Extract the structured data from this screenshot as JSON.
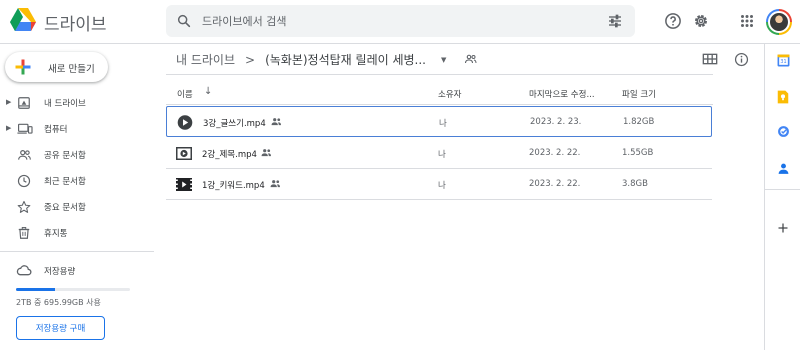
{
  "app": {
    "title": "드라이브",
    "colors": {
      "accent": "#1a73e8",
      "border": "#dadce0",
      "search_bg": "#f1f3f4"
    }
  },
  "header": {
    "search_placeholder": "드라이브에서 검색",
    "icons": [
      "search-icon",
      "tune-icon",
      "help-icon",
      "settings-icon",
      "apps-icon",
      "avatar"
    ]
  },
  "sidebar": {
    "new_button_label": "새로 만들기",
    "items": [
      {
        "label": "내 드라이브",
        "icon": "drive-icon",
        "expandable": true
      },
      {
        "label": "컴퓨터",
        "icon": "computer-icon",
        "expandable": true
      },
      {
        "label": "공유 문서함",
        "icon": "shared-icon",
        "expandable": false
      },
      {
        "label": "최근 문서함",
        "icon": "clock-icon",
        "expandable": false
      },
      {
        "label": "중요 문서함",
        "icon": "star-icon",
        "expandable": false
      },
      {
        "label": "휴지통",
        "icon": "trash-icon",
        "expandable": false
      }
    ],
    "storage": {
      "label": "저장용량",
      "usage_text": "2TB 중 695.99GB 사용",
      "used_fraction": 0.34,
      "buy_button_label": "저장용량 구매"
    }
  },
  "main": {
    "breadcrumb": {
      "root": "내 드라이브",
      "separator": ">",
      "current": "(녹화본)정석탑재 릴레이 세병..."
    },
    "columns": {
      "name": "이름",
      "owner": "소유자",
      "modified": "마지막으로 수정...",
      "size": "파일 크기"
    },
    "files": [
      {
        "name": "3강_글쓰기.mp4",
        "owner": "나",
        "modified": "2023. 2. 23.",
        "size": "1.82GB",
        "selected": true
      },
      {
        "name": "2강_제목.mp4",
        "owner": "나",
        "modified": "2023. 2. 22.",
        "size": "1.55GB",
        "selected": false
      },
      {
        "name": "1강_키워드.mp4",
        "owner": "나",
        "modified": "2023. 2. 22.",
        "size": "3.8GB",
        "selected": false
      }
    ]
  },
  "right_panel": {
    "icons": [
      "calendar-icon",
      "keep-icon",
      "tasks-icon",
      "contacts-icon",
      "add-icon"
    ]
  }
}
